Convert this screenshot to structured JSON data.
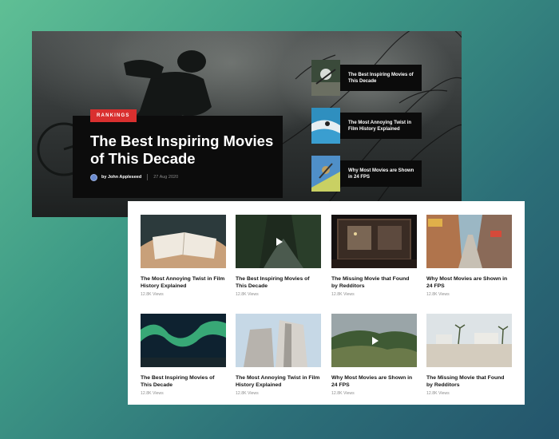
{
  "hero": {
    "tag": "RANKINGS",
    "title": "The Best Inspiring Movies of This Decade",
    "author": "by John Appleseed",
    "date": "27 Aug 2020",
    "side_items": [
      {
        "title": "The Best Inspiring Movies of This Decade"
      },
      {
        "title": "The Most Annoying Twist in Film History Explained"
      },
      {
        "title": "Why Most Movies are Shown in 24 FPS"
      }
    ]
  },
  "grid": {
    "items": [
      {
        "title": "The Most Annoying Twist in Film History Explained",
        "views": "12.8K Views",
        "video": false
      },
      {
        "title": "The Best Inspiring Movies of This Decade",
        "views": "12.8K Views",
        "video": true
      },
      {
        "title": "The Missing Movie that Found by Redditors",
        "views": "12.8K Views",
        "video": false
      },
      {
        "title": "Why Most Movies are Shown in 24 FPS",
        "views": "12.8K Views",
        "video": false
      },
      {
        "title": "The Best Inspiring Movies of This Decade",
        "views": "12.8K Views",
        "video": false
      },
      {
        "title": "The Most Annoying Twist in Film History Explained",
        "views": "12.8K Views",
        "video": false
      },
      {
        "title": "Why Most Movies are Shown in 24 FPS",
        "views": "12.8K Views",
        "video": true
      },
      {
        "title": "The Missing Movie that Found by Redditors",
        "views": "12.8K Views",
        "video": false
      }
    ]
  },
  "colors": {
    "accent": "#d9302f",
    "background_start": "#5fbf95",
    "background_end": "#24556c"
  }
}
